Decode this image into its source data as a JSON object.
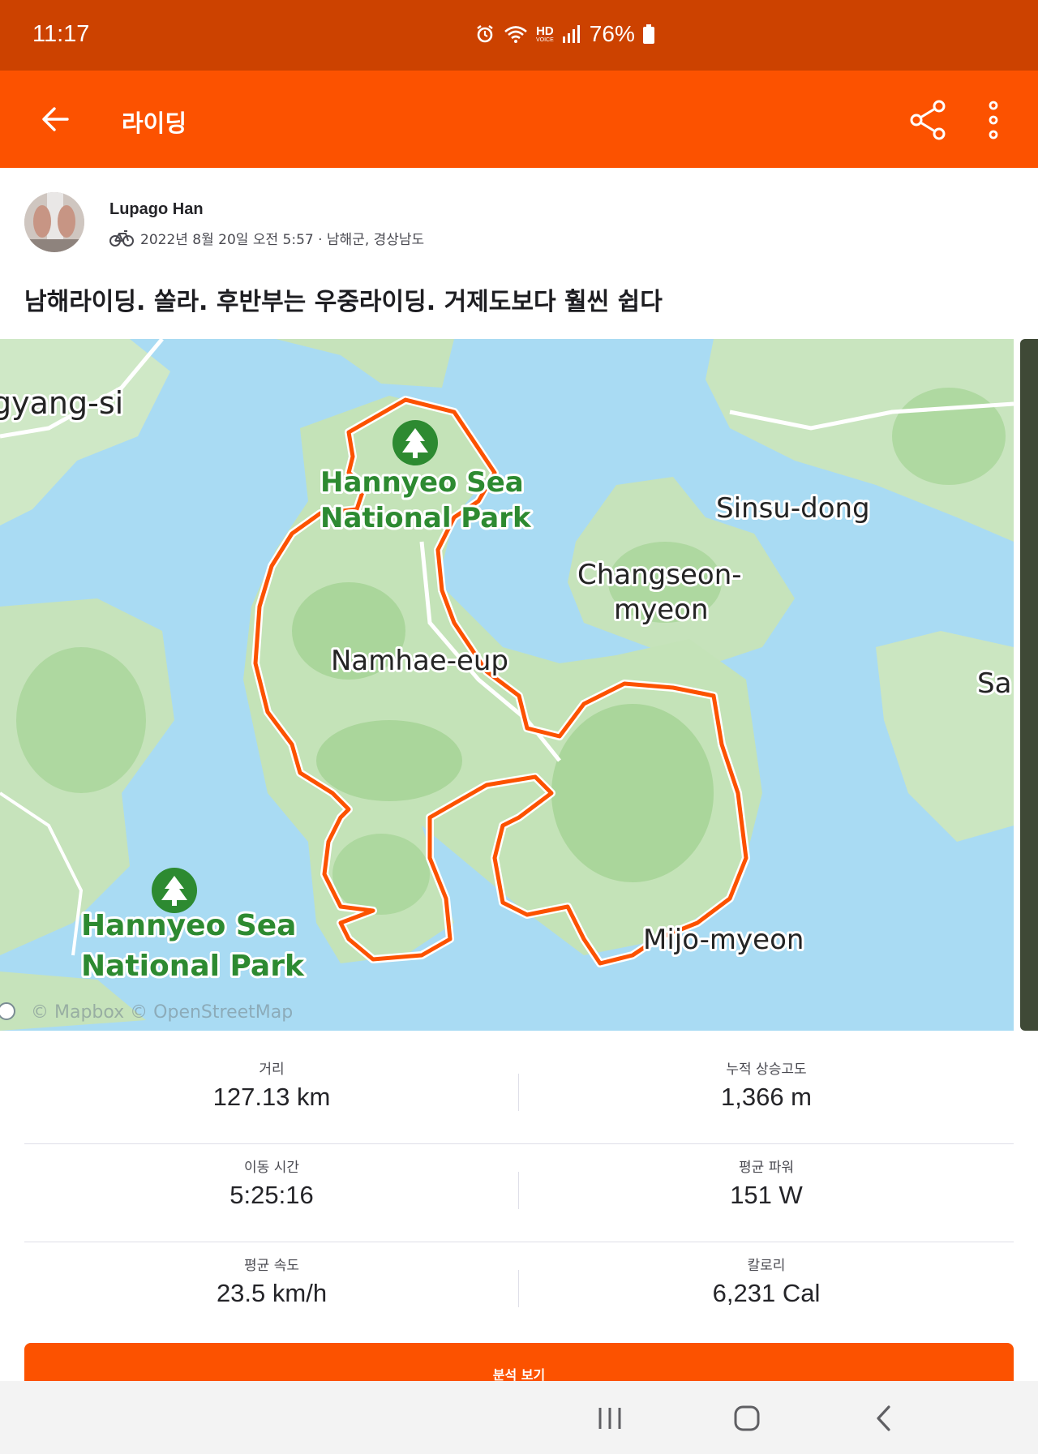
{
  "status_bar": {
    "time": "11:17",
    "network_label": "HD",
    "network_sublabel": "VOICE",
    "battery": "76%"
  },
  "app_bar": {
    "title": "라이딩",
    "back_icon": "arrow-left-icon",
    "share_icon": "share-icon",
    "more_icon": "more-vertical-icon"
  },
  "activity": {
    "athlete_name": "Lupago Han",
    "activity_type_icon": "bike-icon",
    "meta": "2022년 8월 20일 오전 5:57 · 남해군, 경상남도",
    "title": "남해라이딩. 쏠라. 후반부는 우중라이딩. 거제도보다 훨씬 쉽다"
  },
  "map": {
    "labels": {
      "gwangyang": "gyang-si",
      "park_top_line1": "Hannyeo Sea",
      "park_top_line2": "National Park",
      "sinsu": "Sinsu-dong",
      "changseon_line1": "Changseon-",
      "changseon_line2": "myeon",
      "namhae": "Namhae-eup",
      "sa": "Sa",
      "park_bottom_line1": "Hannyeo Sea",
      "park_bottom_line2": "National Park",
      "mijo": "Mijo-myeon",
      "attribution": "© Mapbox © OpenStreetMap"
    },
    "route_color": "#fc5200",
    "park_color": "#2d8a31",
    "water_color": "#a9dbf3",
    "land_color": "#c8e6c0"
  },
  "stats": [
    {
      "label": "거리",
      "value": "127.13 km"
    },
    {
      "label": "누적 상승고도",
      "value": "1,366 m"
    },
    {
      "label": "이동 시간",
      "value": "5:25:16"
    },
    {
      "label": "평균 파워",
      "value": "151 W"
    },
    {
      "label": "평균 속도",
      "value": "23.5 km/h"
    },
    {
      "label": "칼로리",
      "value": "6,231 Cal"
    }
  ],
  "analysis_button": "분석 보기",
  "nav_bar": {
    "recents_icon": "recent-apps-icon",
    "home_icon": "home-icon",
    "back_icon": "nav-back-icon"
  }
}
